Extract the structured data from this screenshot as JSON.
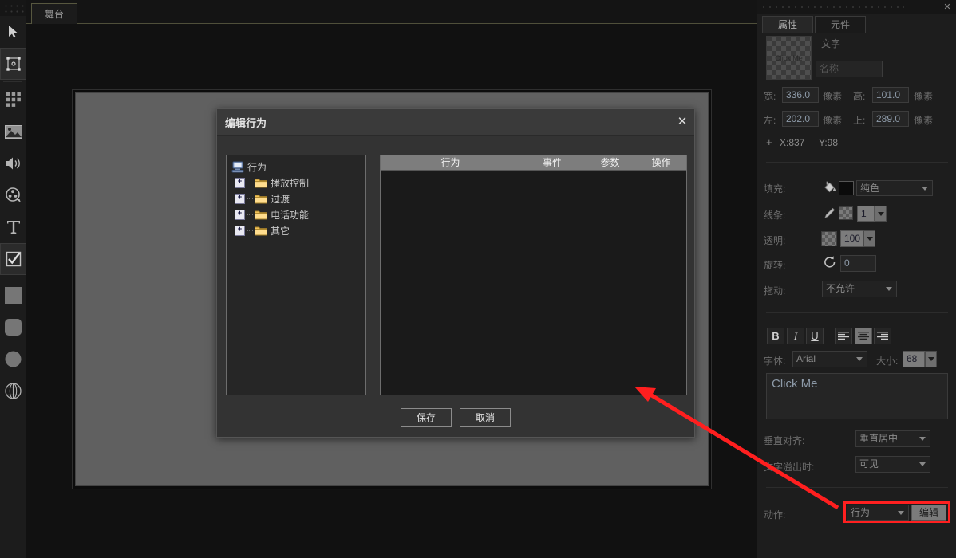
{
  "toolbar": {
    "tools": [
      {
        "name": "select-arrow-tool",
        "label": "选择"
      },
      {
        "name": "transform-tool",
        "label": "变换"
      },
      {
        "name": "grid-tool",
        "label": "网格"
      },
      {
        "name": "image-tool",
        "label": "图片"
      },
      {
        "name": "audio-tool",
        "label": "声音"
      },
      {
        "name": "video-tool",
        "label": "视频"
      },
      {
        "name": "text-tool",
        "label": "文字"
      },
      {
        "name": "checkbox-tool",
        "label": "复选框"
      },
      {
        "name": "rectangle-tool",
        "label": "矩形"
      },
      {
        "name": "rounded-rect-tool",
        "label": "圆角矩形"
      },
      {
        "name": "ellipse-tool",
        "label": "椭圆"
      },
      {
        "name": "globe-tool",
        "label": "全局"
      }
    ]
  },
  "tabbar": {
    "stage_tab": "舞台"
  },
  "dialog": {
    "title": "编辑行为",
    "close_glyph": "✕",
    "tree": {
      "root": "行为",
      "expander_glyph": "+",
      "nodes": [
        {
          "label": "播放控制"
        },
        {
          "label": "过渡"
        },
        {
          "label": "电话功能"
        },
        {
          "label": "其它"
        }
      ]
    },
    "list": {
      "columns": [
        "行为",
        "事件",
        "参数",
        "操作"
      ],
      "rows": []
    },
    "buttons": {
      "save": "保存",
      "cancel": "取消"
    }
  },
  "panel": {
    "close_glyph": "✕",
    "tabs": [
      {
        "label": "属性",
        "active": true
      },
      {
        "label": "元件",
        "active": false
      }
    ],
    "thumbnail_text": "Click Me",
    "type_label": "文字",
    "name_placeholder": "名称",
    "name_value": "",
    "geometry": {
      "width_label": "宽:",
      "width_value": "336.0",
      "width_unit": "像素",
      "height_label": "高:",
      "height_value": "101.0",
      "height_unit": "像素",
      "left_label": "左:",
      "left_value": "202.0",
      "left_unit": "像素",
      "top_label": "上:",
      "top_value": "289.0",
      "top_unit": "像素",
      "plus_glyph": "+",
      "x_readout": "X:837",
      "y_readout": "Y:98"
    },
    "style": {
      "fill_label": "填充:",
      "fill_color": "#0b0b0b",
      "fill_mode": "纯色",
      "line_label": "线条:",
      "line_width": "1",
      "opacity_label": "透明:",
      "opacity_value": "100",
      "rotate_label": "旋转:",
      "rotate_value": "0",
      "drag_label": "拖动:",
      "drag_value": "不允许"
    },
    "text": {
      "bold": "B",
      "italic": "I",
      "underline": "U",
      "align_left_icon": "align-left-icon",
      "align_center_icon": "align-center-icon",
      "align_right_icon": "align-right-icon",
      "font_label": "字体:",
      "font_value": "Arial",
      "size_label": "大小:",
      "size_value": "68",
      "content": "Click Me",
      "valign_label": "垂直对齐:",
      "valign_value": "垂直居中",
      "overflow_label": "文字溢出时:",
      "overflow_value": "可见"
    },
    "action": {
      "label": "动作:",
      "select_value": "行为",
      "edit_button": "编辑"
    }
  },
  "annotation": {
    "arrow_color": "#ff1f1f",
    "highlight_color": "#ff2020"
  }
}
